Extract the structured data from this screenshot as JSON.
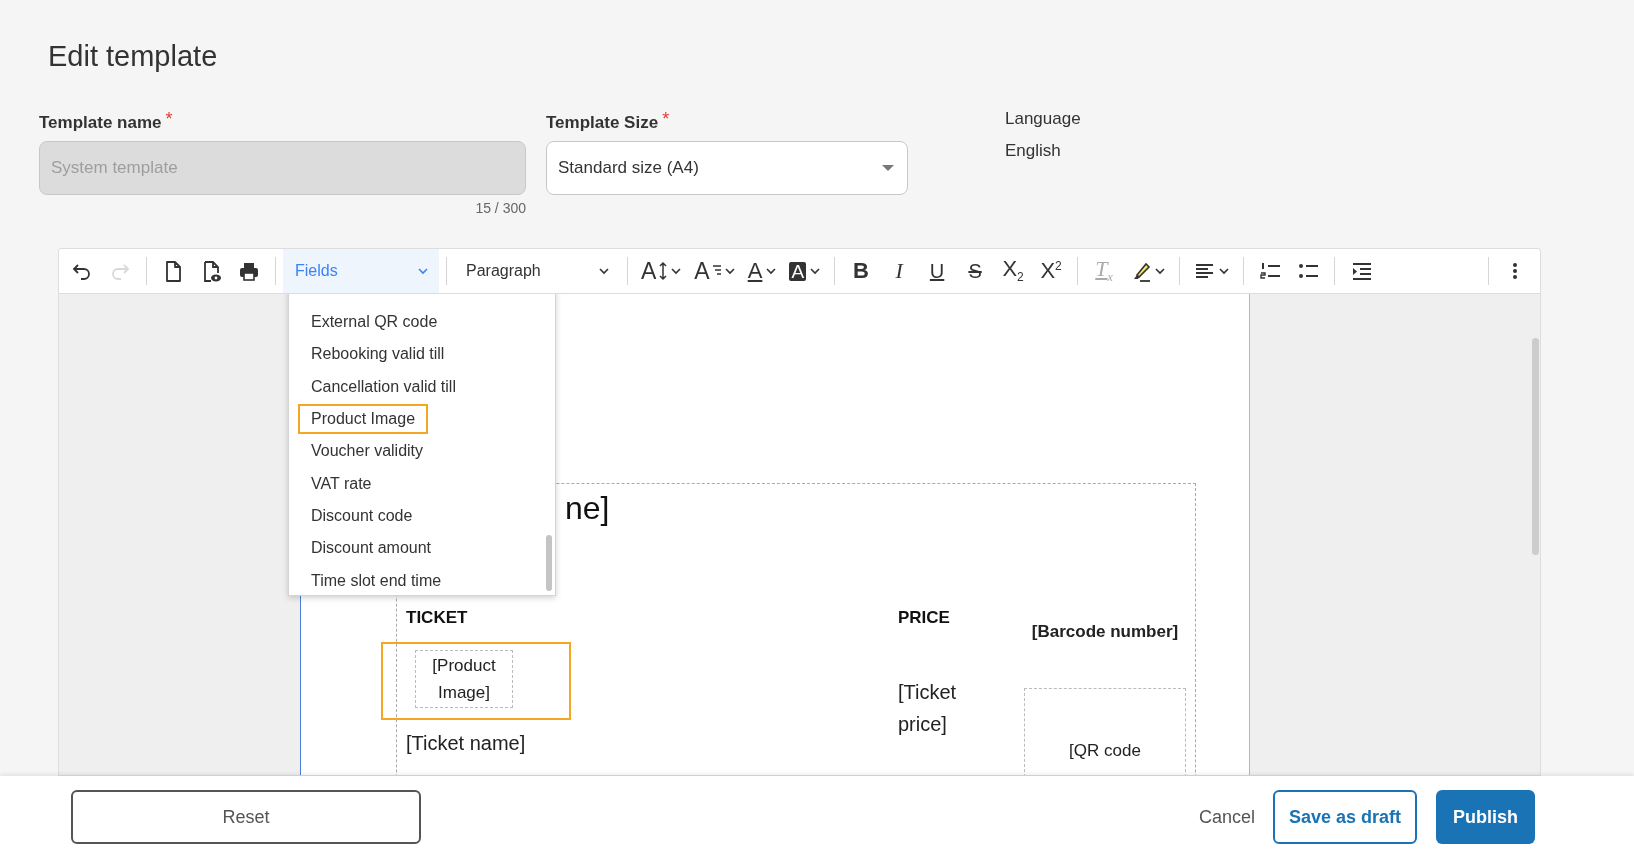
{
  "page_title": "Edit template",
  "form": {
    "name_field": {
      "label": "Template name",
      "required_mark": "*",
      "placeholder": "System template",
      "disabled": true,
      "counter": "15 / 300"
    },
    "size_field": {
      "label": "Template Size",
      "required_mark": "*",
      "value": "Standard size (A4)"
    },
    "language": {
      "label": "Language",
      "value": "English"
    }
  },
  "toolbar": [
    {
      "kind": "undo",
      "disabled": false
    },
    {
      "kind": "redo",
      "disabled": true
    },
    {
      "kind": "divider"
    },
    {
      "kind": "new-document",
      "disabled": false
    },
    {
      "kind": "preview",
      "disabled": false
    },
    {
      "kind": "print",
      "disabled": false
    },
    {
      "kind": "divider"
    },
    {
      "kind": "fields-select",
      "text": "Fields",
      "expanded": true
    },
    {
      "kind": "divider"
    },
    {
      "kind": "paragraph-select",
      "text": "Paragraph",
      "expanded": false
    },
    {
      "kind": "divider"
    },
    {
      "kind": "font-size",
      "glyph": "A",
      "disabled": false
    },
    {
      "kind": "line-height",
      "glyph": "A",
      "disabled": false
    },
    {
      "kind": "font-color",
      "glyph": "A",
      "disabled": false
    },
    {
      "kind": "background-color",
      "glyph": "A",
      "disabled": false
    },
    {
      "kind": "divider"
    },
    {
      "kind": "bold",
      "glyph": "B",
      "disabled": false
    },
    {
      "kind": "italic",
      "glyph": "I",
      "disabled": false
    },
    {
      "kind": "underline",
      "glyph": "U",
      "disabled": false
    },
    {
      "kind": "strikethrough",
      "glyph": "S",
      "disabled": false
    },
    {
      "kind": "subscript",
      "glyph": "X$_{2}$",
      "disabled": false
    },
    {
      "kind": "superscript",
      "glyph": "X$^{2}$",
      "disabled": false
    },
    {
      "kind": "divider"
    },
    {
      "kind": "clear-format",
      "glyph": "T$_{x}$",
      "disabled": true
    },
    {
      "kind": "highlight",
      "disabled": false
    },
    {
      "kind": "divider"
    },
    {
      "kind": "align",
      "disabled": false
    },
    {
      "kind": "divider"
    },
    {
      "kind": "numbered-list",
      "disabled": false
    },
    {
      "kind": "bullet-list",
      "disabled": false
    },
    {
      "kind": "divider"
    },
    {
      "kind": "indent",
      "disabled": false
    },
    {
      "kind": "divider"
    },
    {
      "kind": "more",
      "disabled": false
    }
  ],
  "fields_menu": {
    "items": [
      {
        "label": "External QR code",
        "selected": false
      },
      {
        "label": "Rebooking valid till",
        "selected": false
      },
      {
        "label": "Cancellation valid till",
        "selected": false
      },
      {
        "label": "Product Image",
        "selected": true
      },
      {
        "label": "Voucher validity",
        "selected": false
      },
      {
        "label": "VAT rate",
        "selected": false
      },
      {
        "label": "Discount code",
        "selected": false
      },
      {
        "label": "Discount amount",
        "selected": false
      },
      {
        "label": "Time slot end time",
        "selected": false
      }
    ]
  },
  "document": {
    "heading": "ne]",
    "ticket_label": "TICKET",
    "product_image": {
      "text": "[Product Image]",
      "selected": true
    },
    "ticket_name": "[Ticket name]",
    "price_label": "PRICE",
    "ticket_price": "[Ticket price]",
    "barcode_number": "[Barcode number]",
    "qr_code": "[QR code"
  },
  "footer": {
    "reset": "Reset",
    "cancel": "Cancel",
    "save_draft": "Save as draft",
    "publish": "Publish"
  }
}
